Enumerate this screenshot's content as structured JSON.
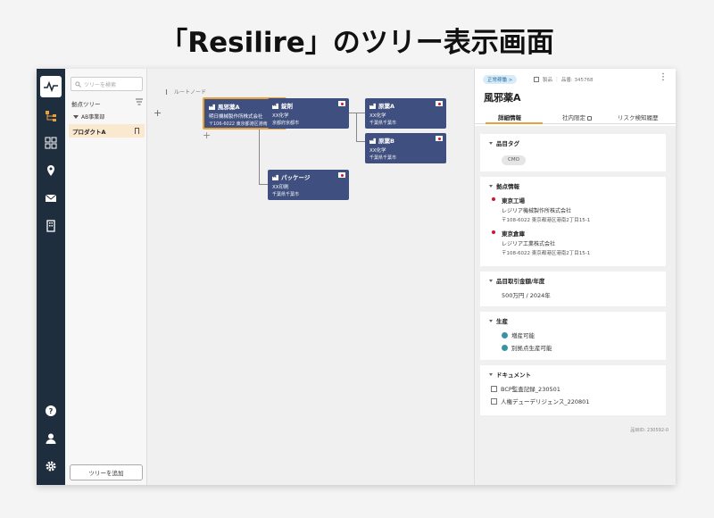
{
  "page_title": "「Resilire」のツリー表示画面",
  "rail": {
    "icons": [
      "logo-icon",
      "tree-icon",
      "grid-icon",
      "location-pin-icon",
      "mail-icon",
      "building-icon",
      "help-icon",
      "user-icon",
      "gear-icon"
    ]
  },
  "tree": {
    "search_placeholder": "ツリーを検索",
    "label": "拠点ツリー",
    "group": "AB事業部",
    "item": "プロダクトA",
    "add_button": "ツリーを追加"
  },
  "canvas": {
    "root_label": "ルートノード",
    "nodes": [
      {
        "name": "風邪薬A",
        "company": "明日機械製作所株式会社",
        "address": "〒106-6022 東京都港区港南"
      },
      {
        "name": "錠剤",
        "company": "XX化学",
        "address": "京都府京都市"
      },
      {
        "name": "パッケージ",
        "company": "XX印刷",
        "address": "千葉県千葉市"
      },
      {
        "name": "原薬A",
        "company": "XX化学",
        "address": "千葉県千葉市"
      },
      {
        "name": "原薬B",
        "company": "XX化学",
        "address": "千葉県千葉市"
      }
    ]
  },
  "detail": {
    "status_badge": "正常稼働 >",
    "product_type": "製品",
    "product_code": "品番: 345768",
    "title": "風邪薬A",
    "tabs": [
      "詳細情報",
      "社内限定",
      "リスク検知履歴"
    ],
    "sections": {
      "tag": {
        "title": "品目タグ",
        "chip": "CMO"
      },
      "sites": {
        "title": "拠点情報",
        "items": [
          {
            "name": "東京工場",
            "company": "レジリア機械製作所株式会社",
            "address": "〒108-6022 東京都港区港南2丁目15-1"
          },
          {
            "name": "東京倉庫",
            "company": "レジリア工業株式会社",
            "address": "〒108-6022 東京都港区港南2丁目15-1"
          }
        ]
      },
      "amount": {
        "title": "品目取引金額/年度",
        "value": "500万円 / 2024年"
      },
      "production": {
        "title": "生産",
        "items": [
          "増産可能",
          "別拠点生産可能"
        ]
      },
      "documents": {
        "title": "ドキュメント",
        "items": [
          "BCP監査記録_230501",
          "人権デューデリジェンス_220801"
        ]
      }
    },
    "item_id": "品目ID: 230592-0"
  },
  "colors": {
    "node_bg": "#3f4f7f",
    "selected_border": "#e8a13a",
    "rail_bg": "#1f2e3e",
    "flag_red": "#d0152a",
    "badge_bg": "#d7ecf8"
  }
}
